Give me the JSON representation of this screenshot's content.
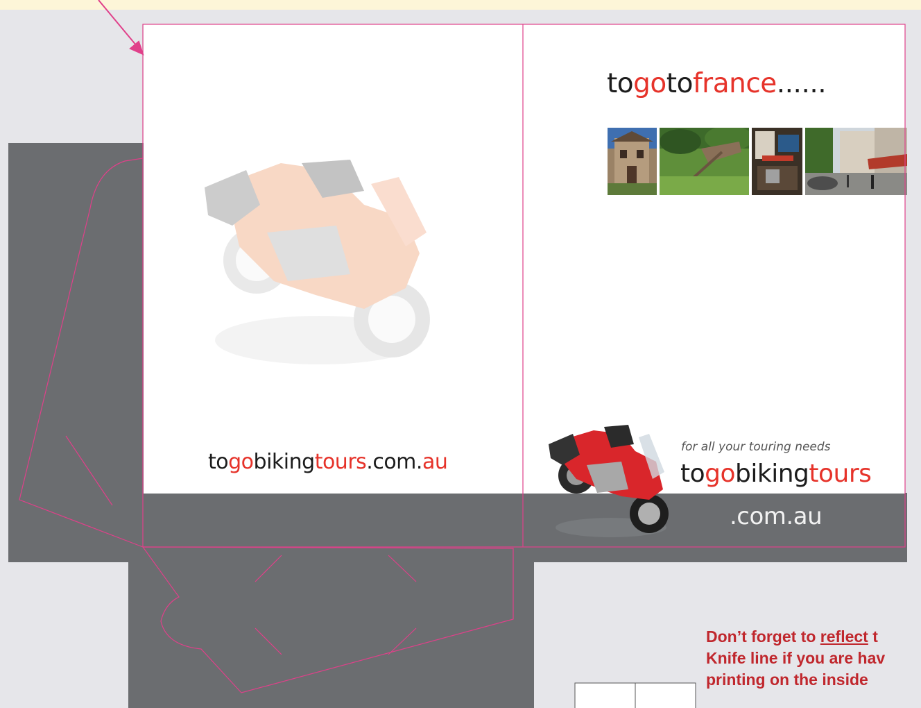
{
  "left_cover": {
    "url_parts": [
      {
        "text": "to",
        "color": "black"
      },
      {
        "text": "go",
        "color": "red"
      },
      {
        "text": "biking",
        "color": "black"
      },
      {
        "text": "tours",
        "color": "red"
      },
      {
        "text": ".com.",
        "color": "black"
      },
      {
        "text": "au",
        "color": "red"
      }
    ]
  },
  "right_cover": {
    "title_parts": [
      {
        "text": "to",
        "color": "black"
      },
      {
        "text": "go",
        "color": "red"
      },
      {
        "text": "to",
        "color": "black"
      },
      {
        "text": "france",
        "color": "red"
      },
      {
        "text": "......",
        "color": "black"
      }
    ],
    "photos": [
      "stone-house-photo",
      "garden-cart-photo",
      "interior-photo",
      "street-scene-photo"
    ],
    "tagline": "for all your touring needs",
    "logo_parts": [
      {
        "text": "to",
        "color": "black"
      },
      {
        "text": "go",
        "color": "red"
      },
      {
        "text": "biking",
        "color": "black"
      },
      {
        "text": "tours",
        "color": "red"
      }
    ],
    "domain_suffix": ".com.au"
  },
  "warning": {
    "line1_before": "Don’t forget to ",
    "line1_underlined": "reflect",
    "line1_after": " t",
    "line2": "Knife line if you are hav",
    "line3": "printing on the inside"
  },
  "colors": {
    "brand_red": "#e6332a",
    "knife_line": "#e0408a",
    "bleed_gray": "#6b6d70",
    "warning_red": "#c0272d"
  }
}
